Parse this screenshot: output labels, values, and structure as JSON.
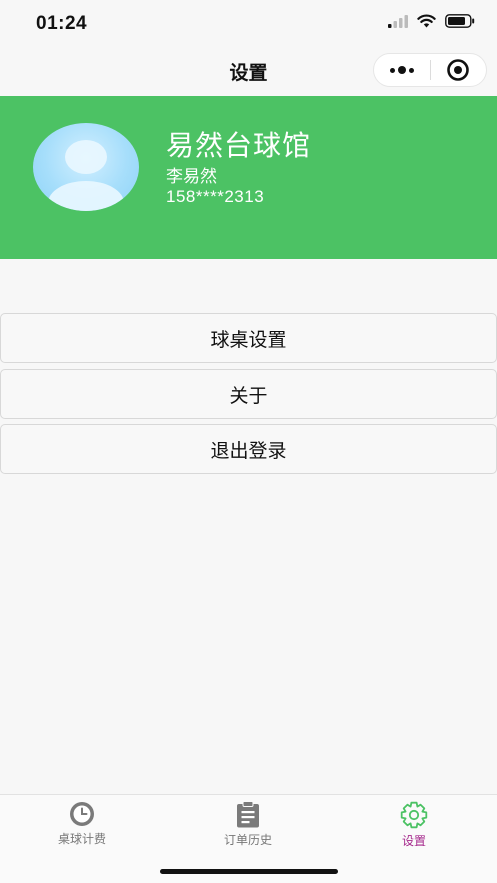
{
  "status_bar": {
    "time": "01:24"
  },
  "nav": {
    "title": "设置"
  },
  "profile": {
    "shop_name": "易然台球馆",
    "owner_name": "李易然",
    "phone": "158****2313"
  },
  "menu": {
    "items": [
      {
        "label": "球桌设置"
      },
      {
        "label": "关于"
      },
      {
        "label": "退出登录"
      }
    ]
  },
  "tabbar": {
    "items": [
      {
        "label": "桌球计费",
        "icon": "clock-icon",
        "active": false
      },
      {
        "label": "订单历史",
        "icon": "clipboard-icon",
        "active": false
      },
      {
        "label": "设置",
        "icon": "gear-icon",
        "active": true
      }
    ],
    "active_color": "#a5288c",
    "inactive_color": "#777777"
  },
  "colors": {
    "header_green": "#4cc264"
  }
}
